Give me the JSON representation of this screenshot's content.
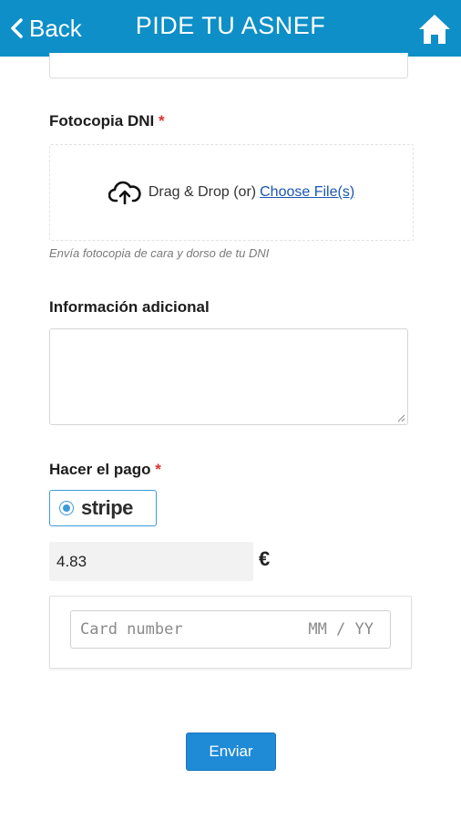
{
  "header": {
    "back_label": "Back",
    "title": "PIDE TU ASNEF",
    "home_icon": "home-icon",
    "bar_color": "#0e8fc7"
  },
  "dni_section": {
    "label": "Fotocopia DNI",
    "required_mark": "*",
    "drop_text": "Drag & Drop (or)",
    "choose_link": "Choose File(s)",
    "upload_icon": "cloud-upload-icon",
    "hint": "Envía fotocopia de cara y dorso de tu DNI"
  },
  "additional_info": {
    "label": "Información adicional",
    "value": ""
  },
  "payment": {
    "label": "Hacer el pago",
    "required_mark": "*",
    "method_selected": "stripe",
    "amount": "4.83",
    "currency": "€",
    "card_placeholder": "Card number",
    "expiry_placeholder": "MM / YY",
    "accent_color": "#3a9bd9"
  },
  "submit": {
    "label": "Enviar",
    "color": "#1f8ad6"
  }
}
